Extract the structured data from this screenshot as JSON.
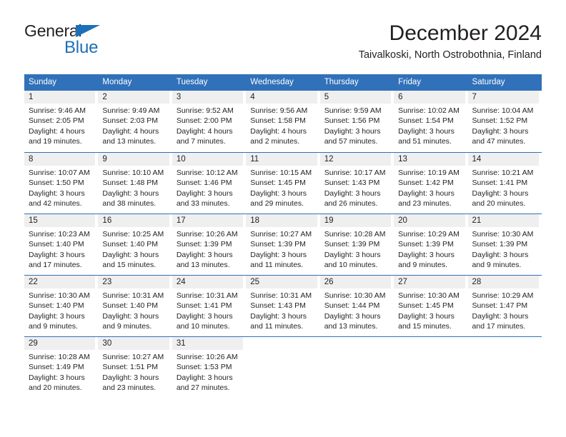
{
  "brand": {
    "name_part1": "General",
    "name_part2": "Blue",
    "triangle_icon": "triangle-icon",
    "color_dark": "#231f20",
    "color_blue": "#1d70b7"
  },
  "header": {
    "title": "December 2024",
    "subtitle": "Taivalkoski, North Ostrobothnia, Finland"
  },
  "theme": {
    "header_blue": "#3071b9",
    "daynum_gray": "#efefef",
    "text": "#231f20"
  },
  "calendar": {
    "weekday_headers": [
      "Sunday",
      "Monday",
      "Tuesday",
      "Wednesday",
      "Thursday",
      "Friday",
      "Saturday"
    ],
    "weeks": [
      [
        {
          "day": "1",
          "sunrise": "Sunrise: 9:46 AM",
          "sunset": "Sunset: 2:05 PM",
          "daylight1": "Daylight: 4 hours",
          "daylight2": "and 19 minutes."
        },
        {
          "day": "2",
          "sunrise": "Sunrise: 9:49 AM",
          "sunset": "Sunset: 2:03 PM",
          "daylight1": "Daylight: 4 hours",
          "daylight2": "and 13 minutes."
        },
        {
          "day": "3",
          "sunrise": "Sunrise: 9:52 AM",
          "sunset": "Sunset: 2:00 PM",
          "daylight1": "Daylight: 4 hours",
          "daylight2": "and 7 minutes."
        },
        {
          "day": "4",
          "sunrise": "Sunrise: 9:56 AM",
          "sunset": "Sunset: 1:58 PM",
          "daylight1": "Daylight: 4 hours",
          "daylight2": "and 2 minutes."
        },
        {
          "day": "5",
          "sunrise": "Sunrise: 9:59 AM",
          "sunset": "Sunset: 1:56 PM",
          "daylight1": "Daylight: 3 hours",
          "daylight2": "and 57 minutes."
        },
        {
          "day": "6",
          "sunrise": "Sunrise: 10:02 AM",
          "sunset": "Sunset: 1:54 PM",
          "daylight1": "Daylight: 3 hours",
          "daylight2": "and 51 minutes."
        },
        {
          "day": "7",
          "sunrise": "Sunrise: 10:04 AM",
          "sunset": "Sunset: 1:52 PM",
          "daylight1": "Daylight: 3 hours",
          "daylight2": "and 47 minutes."
        }
      ],
      [
        {
          "day": "8",
          "sunrise": "Sunrise: 10:07 AM",
          "sunset": "Sunset: 1:50 PM",
          "daylight1": "Daylight: 3 hours",
          "daylight2": "and 42 minutes."
        },
        {
          "day": "9",
          "sunrise": "Sunrise: 10:10 AM",
          "sunset": "Sunset: 1:48 PM",
          "daylight1": "Daylight: 3 hours",
          "daylight2": "and 38 minutes."
        },
        {
          "day": "10",
          "sunrise": "Sunrise: 10:12 AM",
          "sunset": "Sunset: 1:46 PM",
          "daylight1": "Daylight: 3 hours",
          "daylight2": "and 33 minutes."
        },
        {
          "day": "11",
          "sunrise": "Sunrise: 10:15 AM",
          "sunset": "Sunset: 1:45 PM",
          "daylight1": "Daylight: 3 hours",
          "daylight2": "and 29 minutes."
        },
        {
          "day": "12",
          "sunrise": "Sunrise: 10:17 AM",
          "sunset": "Sunset: 1:43 PM",
          "daylight1": "Daylight: 3 hours",
          "daylight2": "and 26 minutes."
        },
        {
          "day": "13",
          "sunrise": "Sunrise: 10:19 AM",
          "sunset": "Sunset: 1:42 PM",
          "daylight1": "Daylight: 3 hours",
          "daylight2": "and 23 minutes."
        },
        {
          "day": "14",
          "sunrise": "Sunrise: 10:21 AM",
          "sunset": "Sunset: 1:41 PM",
          "daylight1": "Daylight: 3 hours",
          "daylight2": "and 20 minutes."
        }
      ],
      [
        {
          "day": "15",
          "sunrise": "Sunrise: 10:23 AM",
          "sunset": "Sunset: 1:40 PM",
          "daylight1": "Daylight: 3 hours",
          "daylight2": "and 17 minutes."
        },
        {
          "day": "16",
          "sunrise": "Sunrise: 10:25 AM",
          "sunset": "Sunset: 1:40 PM",
          "daylight1": "Daylight: 3 hours",
          "daylight2": "and 15 minutes."
        },
        {
          "day": "17",
          "sunrise": "Sunrise: 10:26 AM",
          "sunset": "Sunset: 1:39 PM",
          "daylight1": "Daylight: 3 hours",
          "daylight2": "and 13 minutes."
        },
        {
          "day": "18",
          "sunrise": "Sunrise: 10:27 AM",
          "sunset": "Sunset: 1:39 PM",
          "daylight1": "Daylight: 3 hours",
          "daylight2": "and 11 minutes."
        },
        {
          "day": "19",
          "sunrise": "Sunrise: 10:28 AM",
          "sunset": "Sunset: 1:39 PM",
          "daylight1": "Daylight: 3 hours",
          "daylight2": "and 10 minutes."
        },
        {
          "day": "20",
          "sunrise": "Sunrise: 10:29 AM",
          "sunset": "Sunset: 1:39 PM",
          "daylight1": "Daylight: 3 hours",
          "daylight2": "and 9 minutes."
        },
        {
          "day": "21",
          "sunrise": "Sunrise: 10:30 AM",
          "sunset": "Sunset: 1:39 PM",
          "daylight1": "Daylight: 3 hours",
          "daylight2": "and 9 minutes."
        }
      ],
      [
        {
          "day": "22",
          "sunrise": "Sunrise: 10:30 AM",
          "sunset": "Sunset: 1:40 PM",
          "daylight1": "Daylight: 3 hours",
          "daylight2": "and 9 minutes."
        },
        {
          "day": "23",
          "sunrise": "Sunrise: 10:31 AM",
          "sunset": "Sunset: 1:40 PM",
          "daylight1": "Daylight: 3 hours",
          "daylight2": "and 9 minutes."
        },
        {
          "day": "24",
          "sunrise": "Sunrise: 10:31 AM",
          "sunset": "Sunset: 1:41 PM",
          "daylight1": "Daylight: 3 hours",
          "daylight2": "and 10 minutes."
        },
        {
          "day": "25",
          "sunrise": "Sunrise: 10:31 AM",
          "sunset": "Sunset: 1:43 PM",
          "daylight1": "Daylight: 3 hours",
          "daylight2": "and 11 minutes."
        },
        {
          "day": "26",
          "sunrise": "Sunrise: 10:30 AM",
          "sunset": "Sunset: 1:44 PM",
          "daylight1": "Daylight: 3 hours",
          "daylight2": "and 13 minutes."
        },
        {
          "day": "27",
          "sunrise": "Sunrise: 10:30 AM",
          "sunset": "Sunset: 1:45 PM",
          "daylight1": "Daylight: 3 hours",
          "daylight2": "and 15 minutes."
        },
        {
          "day": "28",
          "sunrise": "Sunrise: 10:29 AM",
          "sunset": "Sunset: 1:47 PM",
          "daylight1": "Daylight: 3 hours",
          "daylight2": "and 17 minutes."
        }
      ],
      [
        {
          "day": "29",
          "sunrise": "Sunrise: 10:28 AM",
          "sunset": "Sunset: 1:49 PM",
          "daylight1": "Daylight: 3 hours",
          "daylight2": "and 20 minutes."
        },
        {
          "day": "30",
          "sunrise": "Sunrise: 10:27 AM",
          "sunset": "Sunset: 1:51 PM",
          "daylight1": "Daylight: 3 hours",
          "daylight2": "and 23 minutes."
        },
        {
          "day": "31",
          "sunrise": "Sunrise: 10:26 AM",
          "sunset": "Sunset: 1:53 PM",
          "daylight1": "Daylight: 3 hours",
          "daylight2": "and 27 minutes."
        },
        {
          "day": "",
          "sunrise": "",
          "sunset": "",
          "daylight1": "",
          "daylight2": ""
        },
        {
          "day": "",
          "sunrise": "",
          "sunset": "",
          "daylight1": "",
          "daylight2": ""
        },
        {
          "day": "",
          "sunrise": "",
          "sunset": "",
          "daylight1": "",
          "daylight2": ""
        },
        {
          "day": "",
          "sunrise": "",
          "sunset": "",
          "daylight1": "",
          "daylight2": ""
        }
      ]
    ]
  }
}
